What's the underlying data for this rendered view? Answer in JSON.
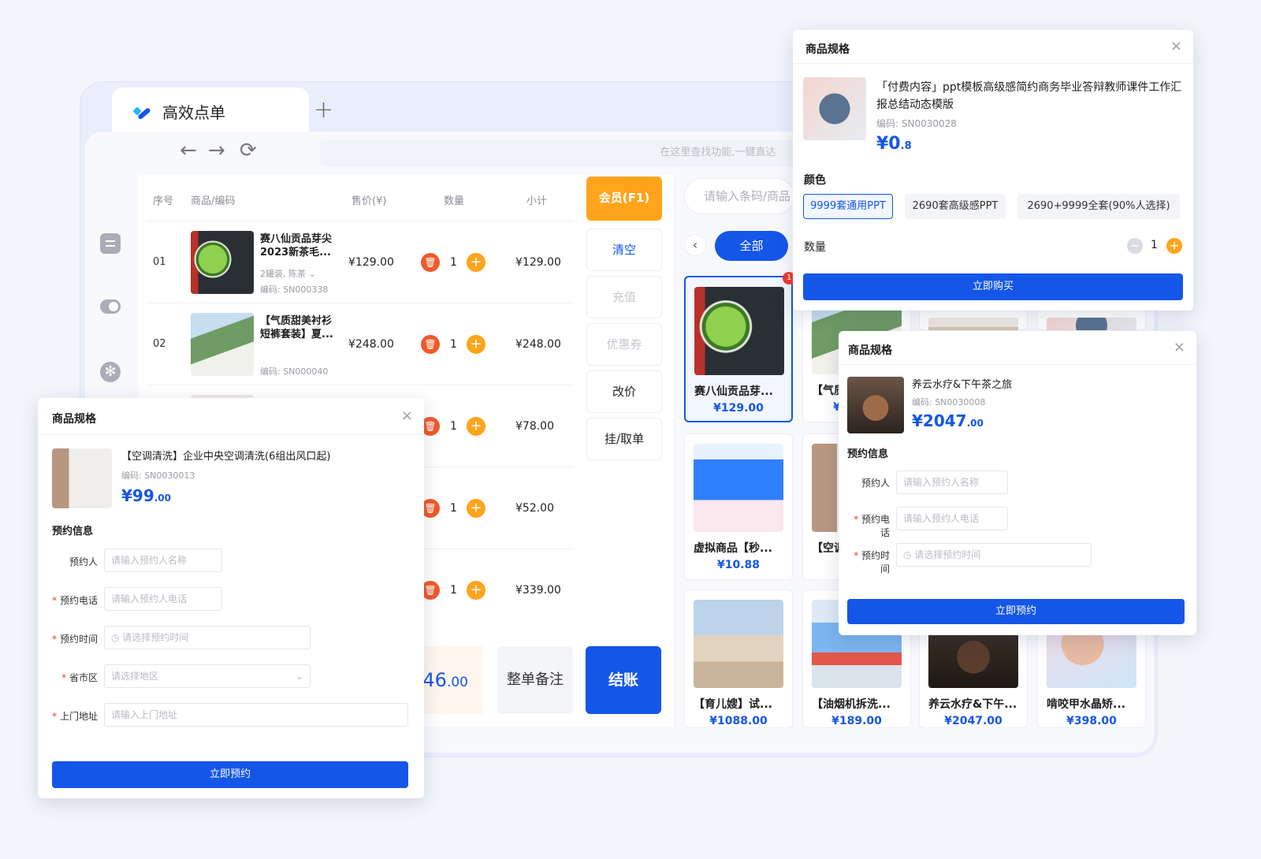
{
  "app": {
    "tab_title": "高效点单",
    "new_tab": "+",
    "back": "←",
    "forward": "→",
    "refresh": "⟳",
    "global_search_placeholder": "在这里查找功能,一键直达"
  },
  "order_table": {
    "headers": [
      "序号",
      "商品/编码",
      "售价(¥)",
      "数量",
      "小计"
    ],
    "rows": [
      {
        "index": "01",
        "name": "赛八仙贡品芽尖2023新茶毛...",
        "spec": "2罐装, 陈茶 ⌄",
        "code": "编码: SN000338",
        "price": "¥129.00",
        "qty": "1",
        "subtotal": "¥129.00",
        "image": "tea"
      },
      {
        "index": "02",
        "name": "【气质甜美衬衫短裤套装】夏...",
        "spec": "",
        "code": "编码: SN000040",
        "price": "¥248.00",
        "qty": "1",
        "subtotal": "¥248.00",
        "image": "dress"
      },
      {
        "index": "",
        "name": "",
        "spec": "",
        "code": "",
        "price": "",
        "qty": "1",
        "subtotal": "¥78.00",
        "image": ""
      },
      {
        "index": "",
        "name": "",
        "spec": "",
        "code": "",
        "price": "",
        "qty": "1",
        "subtotal": "¥52.00",
        "image": ""
      },
      {
        "index": "",
        "name": "",
        "spec": "",
        "code": "",
        "price": "",
        "qty": "1",
        "subtotal": "¥339.00",
        "image": ""
      }
    ]
  },
  "actions": {
    "member": "会员(F1)",
    "clear": "清空",
    "recharge": "充值",
    "coupon": "优惠券",
    "change_price": "改价",
    "hold": "挂/取单"
  },
  "bottom": {
    "total_main": "46",
    "total_decimal": ".00",
    "remark": "整单备注",
    "checkout": "结账"
  },
  "products": {
    "search_placeholder": "请输入条码/商品",
    "prev": "‹",
    "filter_all": "全部",
    "badge": "1",
    "cards": [
      {
        "name": "赛八仙贡品芽...",
        "price": "¥129.00",
        "image": "tea"
      },
      {
        "name": "【气质",
        "price": "¥",
        "image": "dress"
      },
      {
        "name": "虚拟商品【秒...",
        "price": "¥10.88",
        "image": "video"
      },
      {
        "name": "【空调",
        "price": "",
        "image": "ac"
      },
      {
        "name": "【育儿嫂】试...",
        "price": "¥1088.00",
        "image": "kids"
      },
      {
        "name": "【油烟机拆洗...",
        "price": "¥189.00",
        "image": "hood"
      },
      {
        "name": "养云水疗&下午...",
        "price": "¥2047.00",
        "image": "tea2"
      },
      {
        "name": "啃咬甲水晶矫...",
        "price": "¥398.00",
        "image": "nails"
      }
    ]
  },
  "dialog_ppt": {
    "header": "商品规格",
    "close": "×",
    "title": "「付费内容」ppt模板高级感简约商务毕业答辩教师课件工作汇报总结动态模版",
    "code": "编码: SN0030028",
    "price_main": "¥0",
    "price_decimal": ".8",
    "color_label": "颜色",
    "options": [
      "9999套通用PPT",
      "2690套高级感PPT",
      "2690+9999全套(90%人选择)"
    ],
    "qty_label": "数量",
    "minus": "−",
    "qty": "1",
    "plus": "+",
    "buy": "立即购买"
  },
  "dialog_spa": {
    "header": "商品规格",
    "close": "×",
    "title": "养云水疗&下午茶之旅",
    "code": "编码: SN0030008",
    "price_main": "¥2047",
    "price_decimal": ".00",
    "section": "预约信息",
    "fields": [
      {
        "label": "预约人",
        "required": false,
        "placeholder": "请输入预约人名称"
      },
      {
        "label": "预约电话",
        "required": true,
        "placeholder": "请输入预约人电话"
      },
      {
        "label": "预约时间",
        "required": true,
        "placeholder": "◷ 请选择预约时间"
      }
    ],
    "submit": "立即预约"
  },
  "dialog_ac": {
    "header": "商品规格",
    "close": "×",
    "title": "【空调清洗】企业中央空调清洗(6组出风口起)",
    "code": "编码: SN0030013",
    "price_main": "¥99",
    "price_decimal": ".00",
    "section": "预约信息",
    "fields": [
      {
        "label": "预约人",
        "required": false,
        "placeholder": "请输入预约人名称"
      },
      {
        "label": "预约电话",
        "required": true,
        "placeholder": "请输入预约人电话"
      },
      {
        "label": "预约时间",
        "required": true,
        "placeholder": "◷ 请选择预约时间"
      },
      {
        "label": "省市区",
        "required": true,
        "placeholder": "请选择地区"
      },
      {
        "label": "上门地址",
        "required": true,
        "placeholder": "请输入上门地址"
      }
    ],
    "submit": "立即预约"
  }
}
